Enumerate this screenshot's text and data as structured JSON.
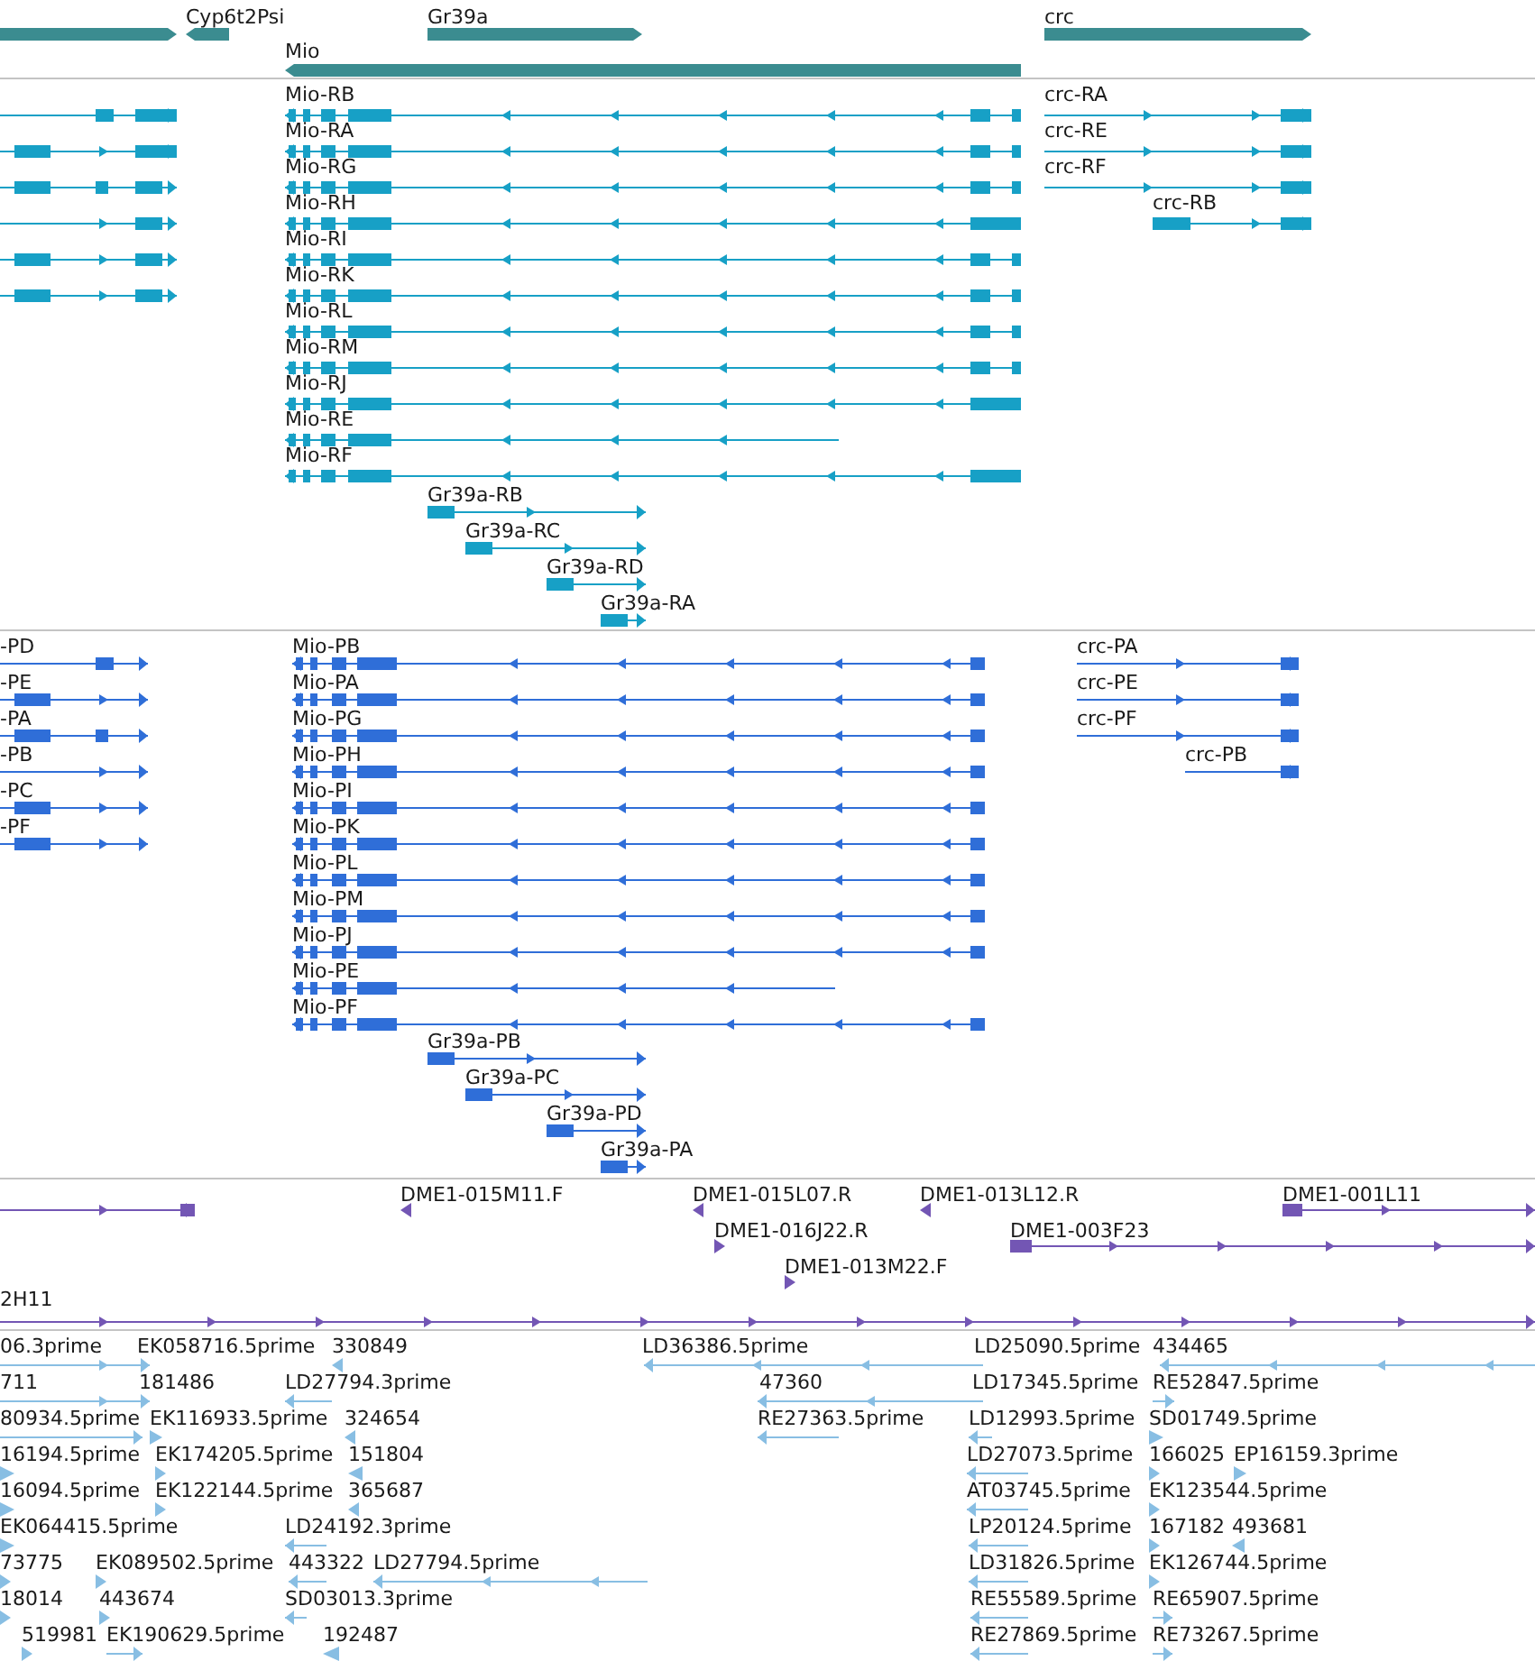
{
  "tracks": [
    {
      "kind": "gene",
      "features": [
        {
          "reverse": false
        },
        {
          "label": "Cyp6t2Psi",
          "reverse": true
        },
        {
          "label": "Gr39a",
          "reverse": false
        },
        {
          "label": "crc",
          "reverse": false
        },
        {
          "label": "Mio",
          "reverse": true
        }
      ]
    },
    {
      "kind": "transcript",
      "features": [
        {
          "reverse": false
        },
        {
          "reverse": false
        },
        {
          "reverse": false
        },
        {
          "reverse": false
        },
        {
          "reverse": false
        },
        {
          "reverse": false
        },
        {
          "label": "Mio-RB",
          "reverse": true
        },
        {
          "label": "Mio-RA",
          "reverse": true
        },
        {
          "label": "Mio-RG",
          "reverse": true
        },
        {
          "label": "Mio-RH",
          "reverse": true
        },
        {
          "label": "Mio-RI",
          "reverse": true
        },
        {
          "label": "Mio-RK",
          "reverse": true
        },
        {
          "label": "Mio-RL",
          "reverse": true
        },
        {
          "label": "Mio-RM",
          "reverse": true
        },
        {
          "label": "Mio-RJ",
          "reverse": true
        },
        {
          "label": "Mio-RE",
          "reverse": true
        },
        {
          "label": "Mio-RF",
          "reverse": true
        },
        {
          "label": "crc-RA",
          "reverse": false
        },
        {
          "label": "crc-RE",
          "reverse": false
        },
        {
          "label": "crc-RF",
          "reverse": false
        },
        {
          "label": "crc-RB",
          "reverse": false
        },
        {
          "label": "Gr39a-RB",
          "reverse": false
        },
        {
          "label": "Gr39a-RC",
          "reverse": false
        },
        {
          "label": "Gr39a-RD",
          "reverse": false
        },
        {
          "label": "Gr39a-RA",
          "reverse": false
        }
      ]
    },
    {
      "kind": "protein",
      "features": [
        {
          "label": "-PD",
          "reverse": false
        },
        {
          "label": "-PE",
          "reverse": false
        },
        {
          "label": "-PA",
          "reverse": false
        },
        {
          "label": "-PB",
          "reverse": false
        },
        {
          "label": "-PC",
          "reverse": false
        },
        {
          "label": "-PF",
          "reverse": false
        },
        {
          "label": "Mio-PB",
          "reverse": true
        },
        {
          "label": "Mio-PA",
          "reverse": true
        },
        {
          "label": "Mio-PG",
          "reverse": true
        },
        {
          "label": "Mio-PH",
          "reverse": true
        },
        {
          "label": "Mio-PI",
          "reverse": true
        },
        {
          "label": "Mio-PK",
          "reverse": true
        },
        {
          "label": "Mio-PL",
          "reverse": true
        },
        {
          "label": "Mio-PM",
          "reverse": true
        },
        {
          "label": "Mio-PJ",
          "reverse": true
        },
        {
          "label": "Mio-PE",
          "reverse": true
        },
        {
          "label": "Mio-PF",
          "reverse": true
        },
        {
          "label": "crc-PA",
          "reverse": false
        },
        {
          "label": "crc-PE",
          "reverse": false
        },
        {
          "label": "crc-PF",
          "reverse": false
        },
        {
          "label": "crc-PB",
          "reverse": false
        },
        {
          "label": "Gr39a-PB",
          "reverse": false
        },
        {
          "label": "Gr39a-PC",
          "reverse": false
        },
        {
          "label": "Gr39a-PD",
          "reverse": false
        },
        {
          "label": "Gr39a-PA",
          "reverse": false
        }
      ]
    },
    {
      "kind": "clone",
      "features": [
        {
          "reverse": false
        },
        {
          "label": "DME1-015M11.F",
          "reverse": true
        },
        {
          "label": "DME1-015L07.R",
          "reverse": true
        },
        {
          "label": "DME1-013L12.R",
          "reverse": true
        },
        {
          "label": "DME1-001L11",
          "reverse": false
        },
        {
          "label": "DME1-016J22.R",
          "reverse": false
        },
        {
          "label": "DME1-003F23",
          "reverse": false
        },
        {
          "label": "DME1-013M22.F",
          "reverse": false
        },
        {
          "label": "2H11",
          "reverse": false
        }
      ]
    },
    {
      "kind": "est",
      "features": [
        {
          "label": "06.3prime",
          "reverse": false
        },
        {
          "label": "EK058716.5prime"
        },
        {
          "label": "330849",
          "reverse": true
        },
        {
          "label": "LD36386.5prime",
          "reverse": true
        },
        {
          "label": "LD25090.5prime"
        },
        {
          "label": "434465",
          "reverse": true
        },
        {
          "label": "711",
          "reverse": false
        },
        {
          "label": "181486"
        },
        {
          "label": "LD27794.3prime",
          "reverse": true
        },
        {
          "label": "47360",
          "reverse": true
        },
        {
          "label": "LD17345.5prime"
        },
        {
          "label": "RE52847.5prime",
          "reverse": false
        },
        {
          "label": "80934.5prime",
          "reverse": false
        },
        {
          "label": "EK116933.5prime",
          "reverse": false
        },
        {
          "label": "324654",
          "reverse": true
        },
        {
          "label": "RE27363.5prime",
          "reverse": true
        },
        {
          "label": "LD12993.5prime",
          "reverse": true
        },
        {
          "label": "SD01749.5prime",
          "reverse": false
        },
        {
          "label": "16194.5prime",
          "reverse": false
        },
        {
          "label": "EK174205.5prime",
          "reverse": false
        },
        {
          "label": "151804",
          "reverse": true
        },
        {
          "label": "LD27073.5prime",
          "reverse": true
        },
        {
          "label": "166025",
          "reverse": false
        },
        {
          "label": "EP16159.3prime",
          "reverse": false
        },
        {
          "label": "16094.5prime",
          "reverse": false
        },
        {
          "label": "EK122144.5prime",
          "reverse": false
        },
        {
          "label": "365687",
          "reverse": true
        },
        {
          "label": "AT03745.5prime",
          "reverse": true
        },
        {
          "label": "EK123544.5prime",
          "reverse": false
        },
        {
          "label": "EK064415.5prime",
          "reverse": false
        },
        {
          "label": "LD24192.3prime",
          "reverse": true
        },
        {
          "label": "LP20124.5prime",
          "reverse": true
        },
        {
          "label": "167182",
          "reverse": false
        },
        {
          "label": "493681",
          "reverse": true
        },
        {
          "label": "73775",
          "reverse": false
        },
        {
          "label": "EK089502.5prime",
          "reverse": false
        },
        {
          "label": "443322",
          "reverse": true
        },
        {
          "label": "LD27794.5prime",
          "reverse": true
        },
        {
          "label": "LD31826.5prime",
          "reverse": true
        },
        {
          "label": "EK126744.5prime",
          "reverse": false
        },
        {
          "label": "18014",
          "reverse": false
        },
        {
          "label": "443674",
          "reverse": false
        },
        {
          "label": "SD03013.3prime",
          "reverse": true
        },
        {
          "label": "RE55589.5prime",
          "reverse": true
        },
        {
          "label": "RE65907.5prime",
          "reverse": false
        },
        {
          "label": "519981",
          "reverse": false
        },
        {
          "label": "EK190629.5prime",
          "reverse": false
        },
        {
          "label": "192487",
          "reverse": true
        },
        {
          "label": "RE27869.5prime",
          "reverse": true
        },
        {
          "label": "RE73267.5prime",
          "reverse": false
        }
      ]
    }
  ]
}
